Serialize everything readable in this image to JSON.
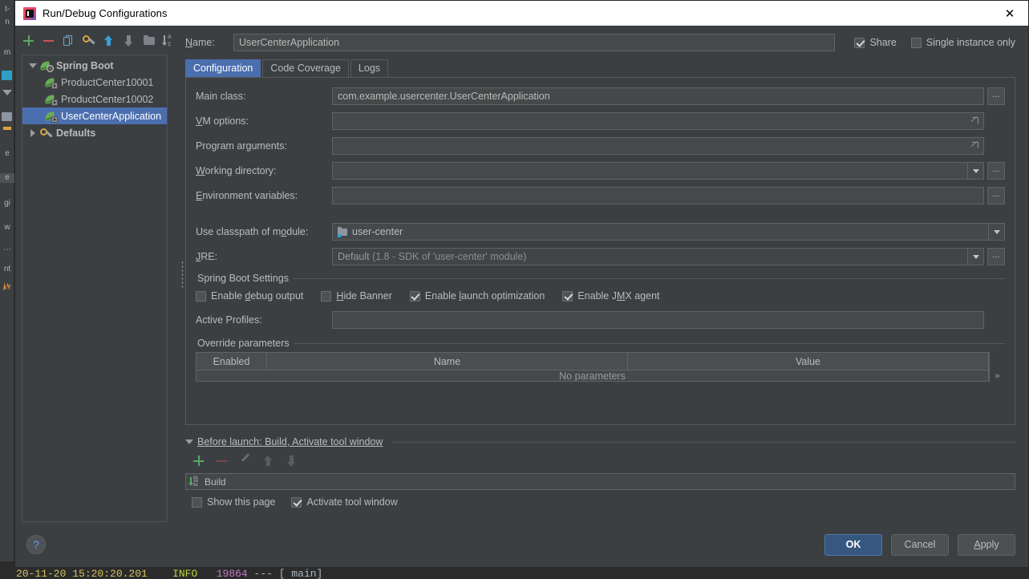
{
  "window": {
    "title": "Run/Debug Configurations",
    "app_icon": "intellij-idea-icon",
    "close_label": "✕"
  },
  "tree_toolbar": {
    "buttons": [
      {
        "name": "add-configuration-button",
        "icon": "plus-icon"
      },
      {
        "name": "remove-configuration-button",
        "icon": "minus-icon"
      },
      {
        "name": "copy-configuration-button",
        "icon": "copy-icon"
      },
      {
        "name": "edit-defaults-button",
        "icon": "wrench-icon"
      },
      {
        "name": "move-up-button",
        "icon": "arrow-up-icon"
      },
      {
        "name": "move-down-button",
        "icon": "arrow-down-icon"
      },
      {
        "name": "create-folder-button",
        "icon": "folder-icon"
      },
      {
        "name": "sort-configurations-button",
        "icon": "sort-az-icon"
      }
    ]
  },
  "tree": {
    "nodes": [
      {
        "label": "Spring Boot",
        "type": "group",
        "icon": "spring-boot-icon",
        "expanded": true,
        "selected": false
      },
      {
        "label": "ProductCenter10001",
        "type": "child",
        "icon": "spring-boot-run-icon",
        "selected": false
      },
      {
        "label": "ProductCenter10002",
        "type": "child",
        "icon": "spring-boot-run-icon",
        "selected": false
      },
      {
        "label": "UserCenterApplication",
        "type": "child",
        "icon": "spring-boot-run-icon",
        "selected": true
      },
      {
        "label": "Defaults",
        "type": "group",
        "icon": "wrench-icon",
        "expanded": false,
        "selected": false
      }
    ]
  },
  "name_row": {
    "label": "Name:",
    "value": "UserCenterApplication",
    "share": {
      "label": "Share",
      "checked": true
    },
    "single_instance": {
      "label": "Single instance only",
      "checked": false
    }
  },
  "tabs": [
    {
      "label": "Configuration",
      "active": true
    },
    {
      "label": "Code Coverage",
      "active": false
    },
    {
      "label": "Logs",
      "active": false
    }
  ],
  "configuration": {
    "main_class": {
      "label": "Main class:",
      "value": "com.example.usercenter.UserCenterApplication",
      "browse": "..."
    },
    "vm_options": {
      "label": "VM options:",
      "value": ""
    },
    "program_arguments": {
      "label": "Program arguments:",
      "value": ""
    },
    "working_directory": {
      "label": "Working directory:",
      "value": "",
      "browse": "..."
    },
    "environment_variables": {
      "label": "Environment variables:",
      "value": "",
      "browse": "..."
    },
    "use_classpath_of_module": {
      "label": "Use classpath of module:",
      "value": "user-center",
      "icon": "module-icon"
    },
    "jre": {
      "label": "JRE:",
      "value": "Default",
      "hint": "(1.8 - SDK of 'user-center' module)",
      "browse": "..."
    }
  },
  "spring_boot_settings": {
    "title": "Spring Boot Settings",
    "checkboxes": [
      {
        "label": "Enable debug output",
        "checked": false
      },
      {
        "label": "Hide Banner",
        "checked": false
      },
      {
        "label": "Enable launch optimization",
        "checked": true
      },
      {
        "label": "Enable JMX agent",
        "checked": true
      }
    ],
    "active_profiles": {
      "label": "Active Profiles:",
      "value": ""
    },
    "override_parameters": {
      "title": "Override parameters",
      "columns": [
        "Enabled",
        "Name",
        "Value"
      ],
      "empty_text": "No parameters",
      "expand_label": "»"
    }
  },
  "before_launch": {
    "title": "Before launch: Build, Activate tool window",
    "toolbar": [
      {
        "name": "add-task-button",
        "icon": "plus-icon",
        "enabled": true
      },
      {
        "name": "remove-task-button",
        "icon": "minus-icon",
        "enabled": false
      },
      {
        "name": "edit-task-button",
        "icon": "pencil-icon",
        "enabled": false
      },
      {
        "name": "move-task-up-button",
        "icon": "arrow-up-icon",
        "enabled": false
      },
      {
        "name": "move-task-down-button",
        "icon": "arrow-down-icon",
        "enabled": false
      }
    ],
    "tasks": [
      {
        "label": "Build",
        "icon": "build-icon"
      }
    ],
    "show_this_page": {
      "label": "Show this page",
      "checked": false
    },
    "activate_tool_window": {
      "label": "Activate tool window",
      "checked": true
    }
  },
  "footer": {
    "help_label": "?",
    "ok_label": "OK",
    "cancel_label": "Cancel",
    "apply_label": "Apply"
  },
  "background": {
    "left_tool_labels": [
      "e",
      "e",
      "gi",
      "w",
      "⋯",
      "nt"
    ],
    "console_text_date": "20-11-20 15:20:20.201",
    "console_text_level": "INFO",
    "console_text_pid": "19864",
    "console_text_rest": " --- [           main]"
  },
  "colors": {
    "dialog_bg": "#3c3f41",
    "titlebar_bg": "#ffffff",
    "selection_blue": "#4b6eaf",
    "input_bg": "#45494a",
    "border": "#5e6366",
    "accent_green": "#59a869",
    "accent_red": "#c75450",
    "primary_button": "#365880"
  }
}
